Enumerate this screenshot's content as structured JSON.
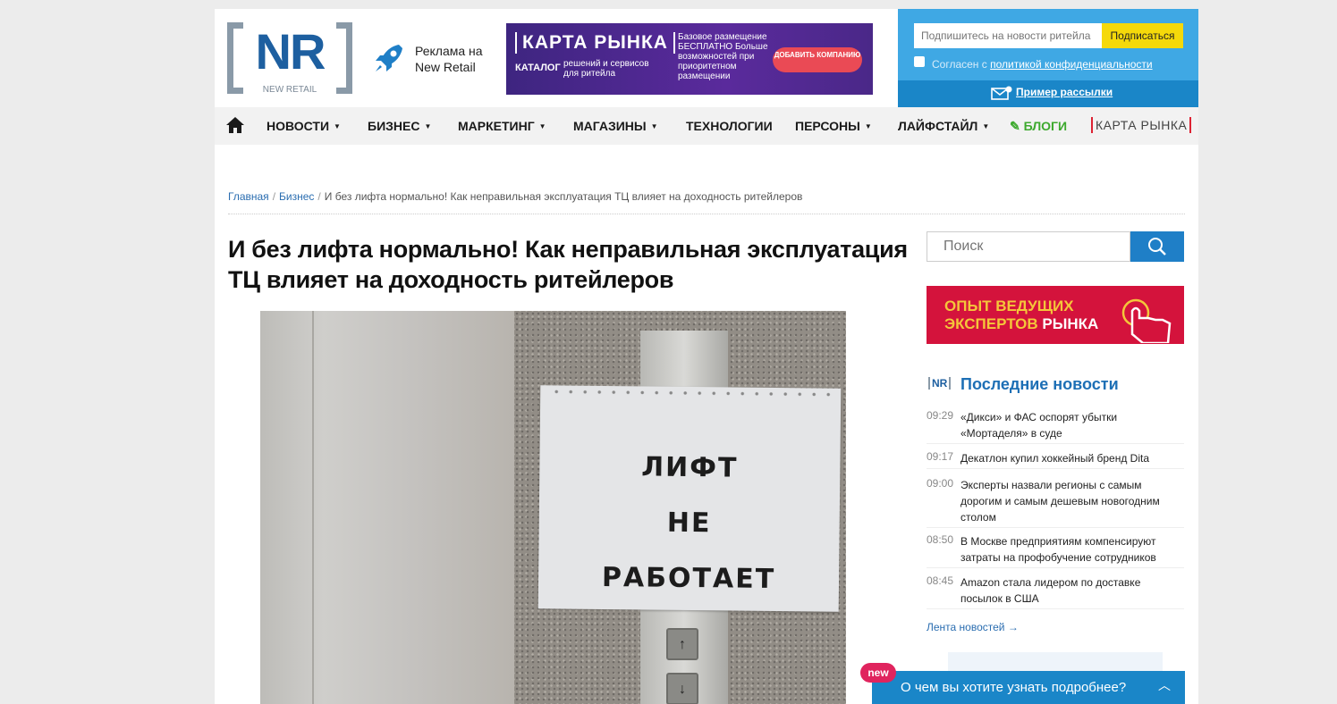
{
  "logo": {
    "mark": "NR",
    "subtitle": "NEW RETAIL"
  },
  "ad_link": {
    "icon": "rocket-icon",
    "line1": "Реклама на",
    "line2": "New Retail"
  },
  "banner": {
    "title": "КАРТА РЫНКА",
    "catalog": "КАТАЛОГ",
    "catalog_sub": "решений и сервисов для ритейла",
    "right_text": "Базовое размещение БЕСПЛАТНО Больше возможностей при приоритетном размещении",
    "button": "ДОБАВИТЬ КОМПАНИЮ"
  },
  "subscribe": {
    "placeholder": "Подпишитесь на новости ритейла",
    "button": "Подписаться",
    "agree_prefix": "Согласен с ",
    "agree_link": "политикой конфиденциальности",
    "example": "Пример рассылки"
  },
  "nav": {
    "items": [
      "НОВОСТИ",
      "БИЗНЕС",
      "МАРКЕТИНГ",
      "МАГАЗИНЫ",
      "ТЕХНОЛОГИИ",
      "ПЕРСОНЫ",
      "ЛАЙФСТАЙЛ",
      "БЛОГИ"
    ],
    "market_map": "КАРТА РЫНКА"
  },
  "breadcrumb": {
    "home": "Главная",
    "section": "Бизнес",
    "current": "И без лифта нормально! Как неправильная эксплуатация ТЦ влияет на доходность ритейлеров"
  },
  "article": {
    "title": "И без лифта нормально! Как неправильная эксплуатация ТЦ влияет на доходность ритейлеров",
    "photo_sign": [
      "ЛИФТ",
      "НЕ",
      "РАБОТАЕТ"
    ]
  },
  "sidebar": {
    "search_placeholder": "Поиск",
    "promo_line1": "ОПЫТ ВЕДУЩИХ",
    "promo_line2a": "ЭКСПЕРТОВ",
    "promo_line2b": "РЫНКА",
    "news_mark": "NR",
    "news_title": "Последние новости",
    "news": [
      {
        "time": "09:29",
        "headline": "«Дикси» и ФАС оспорят убытки «Мортаделя» в суде"
      },
      {
        "time": "09:17",
        "headline": "Декатлон купил хоккейный бренд Dita"
      },
      {
        "time": "09:00",
        "headline": "Эксперты назвали регионы с самым дорогим и самым дешевым новогодним столом"
      },
      {
        "time": "08:50",
        "headline": "В Москве предприятиям компенсируют затраты на профобучение сотрудников"
      },
      {
        "time": "08:45",
        "headline": "Amazon стала лидером по доставке посылок в США"
      }
    ],
    "feed_link": "Лента новостей →"
  },
  "chat": {
    "badge": "new",
    "text": "О чем вы хотите узнать подробнее?"
  }
}
